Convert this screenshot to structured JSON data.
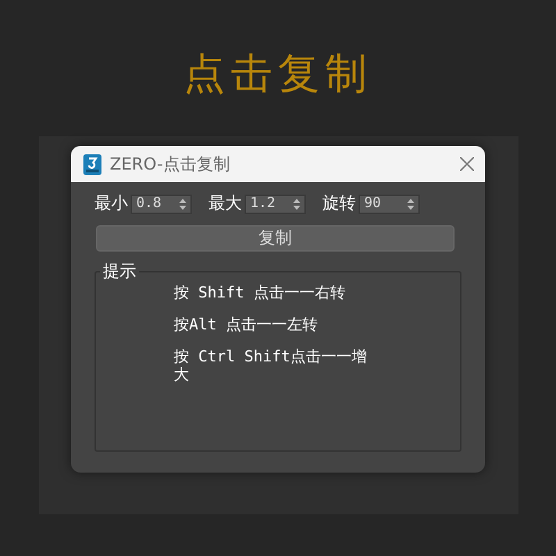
{
  "heading": "点击复制",
  "window": {
    "title": "ZERO-点击复制"
  },
  "spinners": [
    {
      "label": "最小",
      "value": "0.8"
    },
    {
      "label": "最大",
      "value": "1.2"
    },
    {
      "label": "旋转",
      "value": "90"
    }
  ],
  "copy_button": "复制",
  "hints": {
    "title": "提示",
    "lines": [
      "按 Shift 点击一一右转",
      "按Alt 点击一一左转",
      "按 Ctrl Shift点击一一增大"
    ]
  }
}
